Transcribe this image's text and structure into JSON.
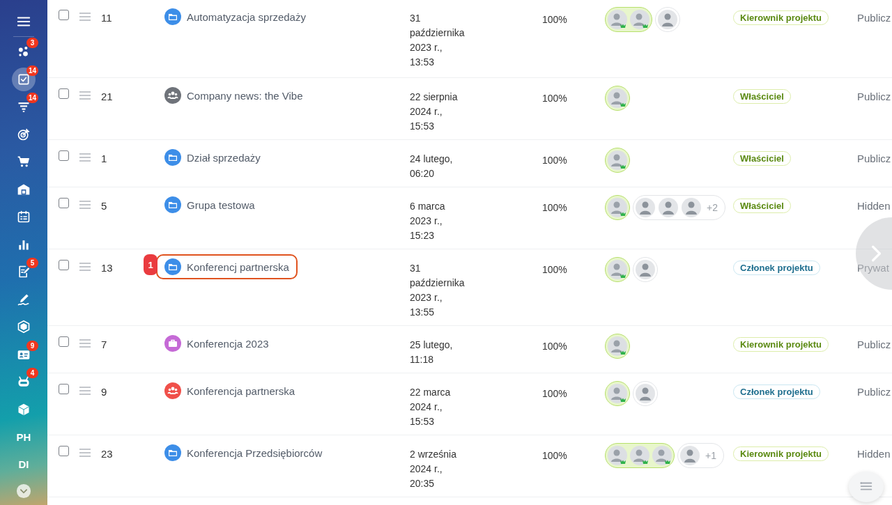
{
  "sidebar": {
    "items": [
      {
        "kind": "icon",
        "badge": "3",
        "selected": false
      },
      {
        "kind": "icon",
        "badge": "14",
        "selected": true
      },
      {
        "kind": "icon",
        "badge": "14",
        "selected": false
      },
      {
        "kind": "icon",
        "selected": false
      },
      {
        "kind": "icon",
        "selected": false
      },
      {
        "kind": "icon",
        "selected": false
      },
      {
        "kind": "icon",
        "selected": false
      },
      {
        "kind": "icon",
        "selected": false
      },
      {
        "kind": "icon",
        "badge": "5",
        "selected": false
      },
      {
        "kind": "icon",
        "selected": false
      },
      {
        "kind": "icon",
        "selected": false
      },
      {
        "kind": "icon",
        "badge": "9",
        "selected": false
      },
      {
        "kind": "icon",
        "badge": "4",
        "selected": false
      },
      {
        "kind": "icon",
        "selected": false
      },
      {
        "kind": "text",
        "label": "PH",
        "selected": false
      },
      {
        "kind": "text",
        "label": "DI",
        "selected": false
      },
      {
        "kind": "more",
        "selected": false
      }
    ]
  },
  "rows": [
    {
      "checked": false,
      "id": "11",
      "icon": {
        "kind": "folder",
        "color": "#3d8ee8"
      },
      "name": "Automatyzacja sprzedaży",
      "highlighted": false,
      "date": [
        "31",
        "października",
        "2023 r.,",
        "13:53"
      ],
      "progress": "100%",
      "owners": [
        {
          "kind": "person"
        },
        {
          "kind": "person"
        }
      ],
      "members": [
        {
          "kind": "person"
        }
      ],
      "role": {
        "kind": "manager",
        "label": "Kierownik projektu"
      },
      "visibility": "Publicz"
    },
    {
      "checked": false,
      "id": "21",
      "icon": {
        "kind": "group",
        "color": "#6f737a"
      },
      "name": "Company news: the Vibe",
      "highlighted": false,
      "date": [
        "22 sierpnia",
        "2024 r.,",
        "15:53"
      ],
      "progress": "100%",
      "owners": [
        {
          "kind": "person"
        }
      ],
      "members": [],
      "role": {
        "kind": "owner",
        "label": "Właściciel"
      },
      "visibility": "Publicz"
    },
    {
      "checked": false,
      "id": "1",
      "icon": {
        "kind": "folder",
        "color": "#3d8ee8"
      },
      "name": "Dział sprzedaży",
      "highlighted": false,
      "date": [
        "24 lutego,",
        "06:20"
      ],
      "progress": "100%",
      "owners": [
        {
          "kind": "person"
        }
      ],
      "members": [],
      "role": {
        "kind": "owner",
        "label": "Właściciel"
      },
      "visibility": "Publicz"
    },
    {
      "checked": false,
      "id": "5",
      "icon": {
        "kind": "folder",
        "color": "#3d8ee8"
      },
      "name": "Grupa testowa",
      "highlighted": false,
      "date": [
        "6 marca",
        "2023 r.,",
        "15:23"
      ],
      "progress": "100%",
      "owners": [
        {
          "kind": "person"
        }
      ],
      "members": [
        {
          "kind": "person"
        },
        {
          "kind": "person"
        },
        {
          "kind": "person"
        }
      ],
      "more": "+2",
      "role": {
        "kind": "owner",
        "label": "Właściciel"
      },
      "visibility": "Hidden"
    },
    {
      "checked": false,
      "id": "13",
      "icon": {
        "kind": "folder",
        "color": "#3d8ee8"
      },
      "name": "Konferencj partnerska",
      "highlighted": true,
      "marker": "1",
      "date": [
        "31",
        "października",
        "2023 r.,",
        "13:55"
      ],
      "progress": "100%",
      "owners": [
        {
          "kind": "person"
        }
      ],
      "members": [
        {
          "kind": "person"
        }
      ],
      "role": {
        "kind": "member",
        "label": "Członek projektu"
      },
      "visibility": "Prywat"
    },
    {
      "checked": false,
      "id": "7",
      "icon": {
        "kind": "briefcase",
        "color": "#c56ad6"
      },
      "name": "Konferencja 2023",
      "highlighted": false,
      "date": [
        "25 lutego,",
        "11:18"
      ],
      "progress": "100%",
      "owners": [
        {
          "kind": "person"
        }
      ],
      "members": [],
      "role": {
        "kind": "manager",
        "label": "Kierownik projektu"
      },
      "visibility": "Publicz"
    },
    {
      "checked": false,
      "id": "9",
      "icon": {
        "kind": "group",
        "color": "#f0504a"
      },
      "name": "Konferencja partnerska",
      "highlighted": false,
      "date": [
        "22 marca",
        "2024 r.,",
        "15:53"
      ],
      "progress": "100%",
      "owners": [
        {
          "kind": "person"
        }
      ],
      "members": [
        {
          "kind": "person"
        }
      ],
      "role": {
        "kind": "member",
        "label": "Członek projektu"
      },
      "visibility": "Publicz"
    },
    {
      "checked": false,
      "id": "23",
      "icon": {
        "kind": "folder",
        "color": "#3d8ee8"
      },
      "name": "Konferencja Przedsiębiorców",
      "highlighted": false,
      "date": [
        "2 września",
        "2024 r.,",
        "20:35"
      ],
      "progress": "100%",
      "owners": [
        {
          "kind": "person"
        },
        {
          "kind": "person"
        },
        {
          "kind": "person"
        }
      ],
      "members": [
        {
          "kind": "person"
        }
      ],
      "more": "+1",
      "role": {
        "kind": "manager",
        "label": "Kierownik projektu"
      },
      "visibility": "Hidden"
    }
  ]
}
